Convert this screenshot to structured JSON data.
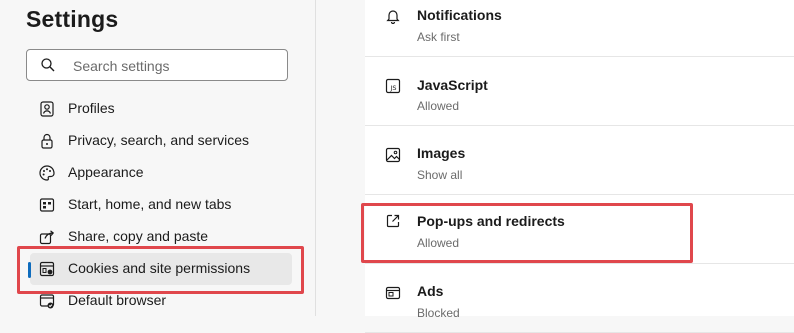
{
  "settings": {
    "title": "Settings",
    "search": {
      "placeholder": "Search settings"
    },
    "nav": [
      {
        "label": "Profiles",
        "icon": "profiles-icon"
      },
      {
        "label": "Privacy, search, and services",
        "icon": "lock-icon"
      },
      {
        "label": "Appearance",
        "icon": "palette-icon"
      },
      {
        "label": "Start, home, and new tabs",
        "icon": "home-tabs-icon"
      },
      {
        "label": "Share, copy and paste",
        "icon": "share-icon"
      },
      {
        "label": "Cookies and site permissions",
        "icon": "cookies-permissions-icon",
        "active": true
      },
      {
        "label": "Default browser",
        "icon": "default-browser-icon"
      }
    ]
  },
  "permissions": [
    {
      "title": "Notifications",
      "status": "Ask first",
      "icon": "bell-icon"
    },
    {
      "title": "JavaScript",
      "status": "Allowed",
      "icon": "javascript-icon"
    },
    {
      "title": "Images",
      "status": "Show all",
      "icon": "image-icon"
    },
    {
      "title": "Pop-ups and redirects",
      "status": "Allowed",
      "icon": "external-link-icon"
    },
    {
      "title": "Ads",
      "status": "Blocked",
      "icon": "ads-icon"
    }
  ],
  "colors": {
    "accent": "#0f6cbd",
    "highlight": "#e0474c"
  }
}
